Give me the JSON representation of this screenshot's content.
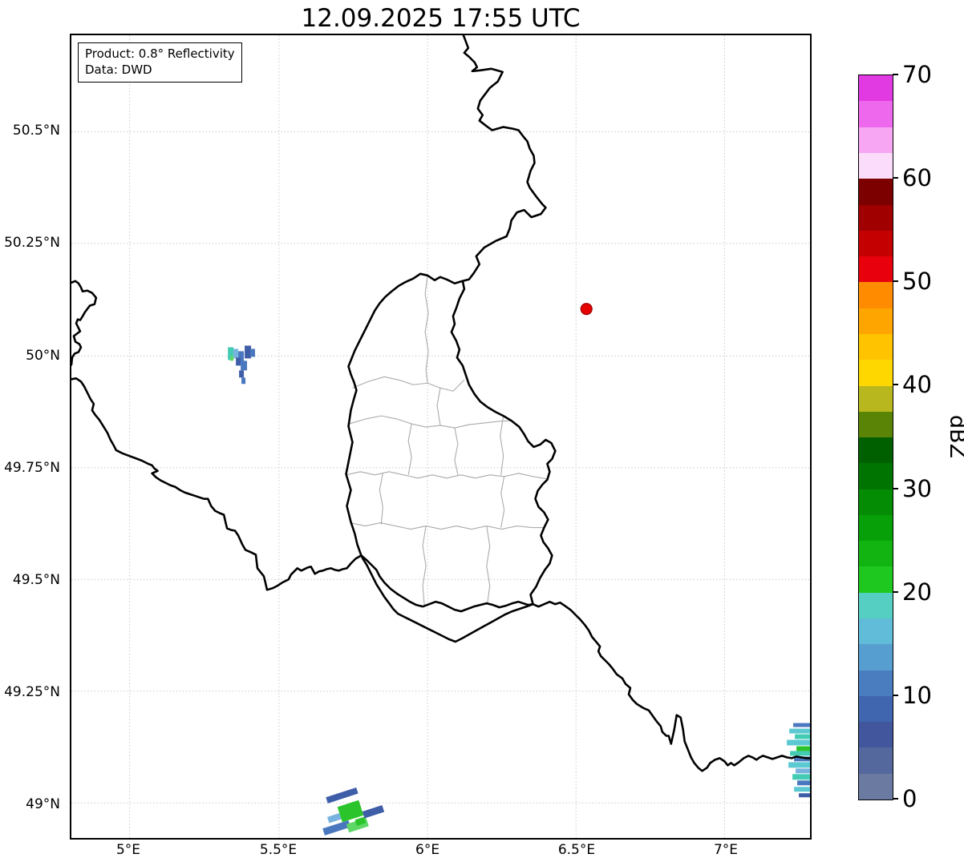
{
  "title": "12.09.2025 17:55 UTC",
  "info_box": {
    "product": "Product: 0.8° Reflectivity",
    "data_source": "Data: DWD"
  },
  "axes": {
    "x_ticks": [
      {
        "label": "5°E",
        "frac": 0.0789
      },
      {
        "label": "5.5°E",
        "frac": 0.2811
      },
      {
        "label": "6°E",
        "frac": 0.4822
      },
      {
        "label": "6.5°E",
        "frac": 0.6832
      },
      {
        "label": "7°E",
        "frac": 0.8843
      }
    ],
    "y_ticks": [
      {
        "label": "50.5°N",
        "frac": 0.1203
      },
      {
        "label": "50.25°N",
        "frac": 0.2594
      },
      {
        "label": "50°N",
        "frac": 0.3996
      },
      {
        "label": "49.75°N",
        "frac": 0.5388
      },
      {
        "label": "49.5°N",
        "frac": 0.678
      },
      {
        "label": "49.25°N",
        "frac": 0.8171
      },
      {
        "label": "49°N",
        "frac": 0.9563
      }
    ]
  },
  "colorbar": {
    "label": "dBZ",
    "min": 0,
    "max": 70,
    "tick_values": [
      0,
      10,
      20,
      30,
      40,
      50,
      60,
      70
    ],
    "segment_dbz": 2.5,
    "colors_bottom_to_top": [
      "#6a7aa0",
      "#55689e",
      "#41569c",
      "#4066b0",
      "#4a7cc0",
      "#569ed0",
      "#60bcd8",
      "#54cfc2",
      "#1ec81e",
      "#12b412",
      "#08a008",
      "#048c04",
      "#007400",
      "#006000",
      "#5a8406",
      "#b8b81e",
      "#ffd700",
      "#ffc300",
      "#ffa500",
      "#ff8c00",
      "#e8000d",
      "#c40000",
      "#a00000",
      "#7c0000",
      "#fbdcfa",
      "#f6a6f2",
      "#ee68ee",
      "#e23ae2"
    ]
  },
  "map": {
    "marker": {
      "color": "#e60000",
      "edge_color": "#990000",
      "approx_lon": "6.53°E",
      "approx_lat": "50.1°N"
    },
    "border_color": "#000000",
    "canton_color": "#aaaaaa",
    "grid_color": "#c9c9c9",
    "echo_colors": {
      "blue_dark": "#3f5ea8",
      "blue": "#4a78bf",
      "blue_light": "#78b2de",
      "cyan": "#5cc8d2",
      "teal": "#43cbb4",
      "green": "#2bc52b",
      "green_light": "#5dd765"
    },
    "echo_clusters": [
      {
        "id": "west",
        "approx_lon": "5.35°E",
        "approx_lat": "50°N",
        "levels": "0–20 dBZ"
      },
      {
        "id": "south",
        "approx_lon": "5.75°E",
        "approx_lat": "48.95°N",
        "levels": "0–30 dBZ"
      },
      {
        "id": "east",
        "approx_lon": "7.25°E",
        "approx_lat": "49.13°N",
        "levels": "0–30 dBZ"
      }
    ]
  }
}
